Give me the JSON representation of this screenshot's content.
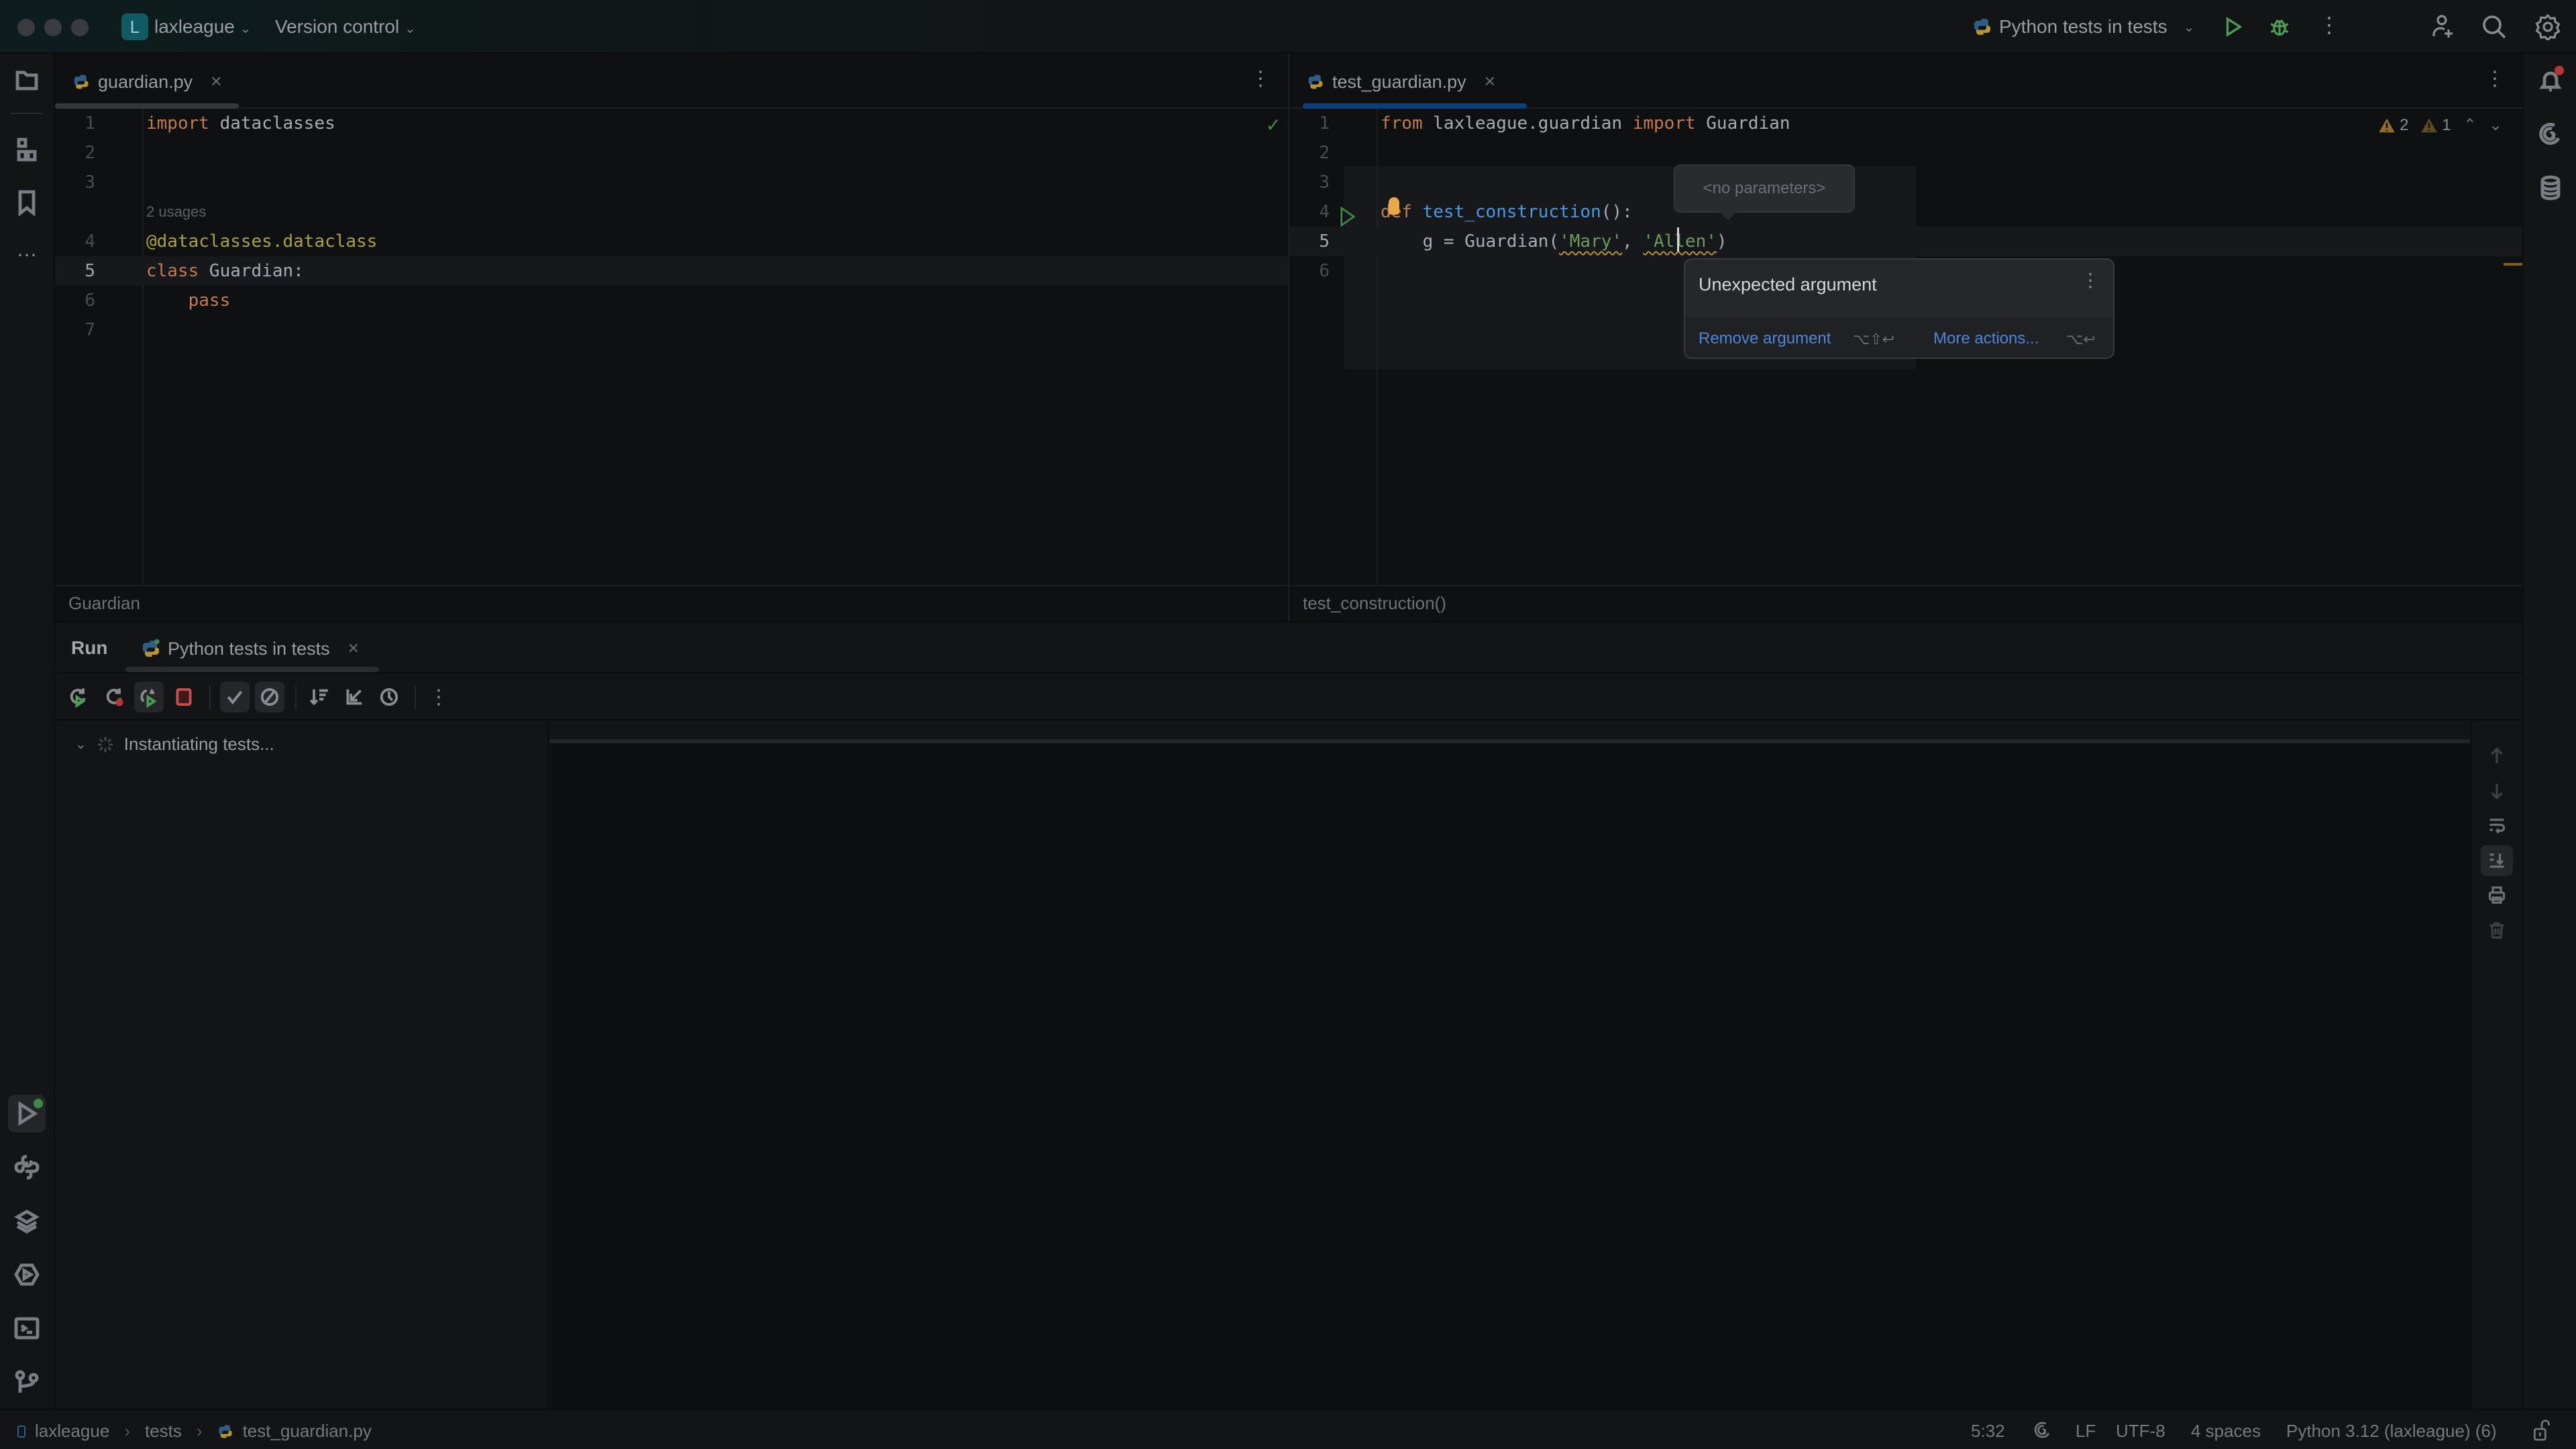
{
  "titlebar": {
    "project_initial": "L",
    "project_name": "laxleague",
    "vcs_label": "Version control",
    "run_config": "Python tests in tests"
  },
  "editors": {
    "left": {
      "tab_label": "guardian.py",
      "breadcrumb": "Guardian",
      "usages_hint": "2 usages",
      "lines": [
        {
          "n": "1",
          "tokens": [
            {
              "t": "import",
              "c": "kw"
            },
            {
              "t": " dataclasses",
              "c": "id"
            }
          ]
        },
        {
          "n": "2",
          "tokens": []
        },
        {
          "n": "3",
          "tokens": []
        },
        {
          "n": "4",
          "tokens": [
            {
              "t": "@dataclasses.dataclass",
              "c": "deco"
            }
          ]
        },
        {
          "n": "5",
          "tokens": [
            {
              "t": "class",
              "c": "kw"
            },
            {
              "t": " Guardian:",
              "c": "id"
            }
          ]
        },
        {
          "n": "6",
          "tokens": [
            {
              "t": "    ",
              "c": "id"
            },
            {
              "t": "pass",
              "c": "kw"
            }
          ]
        },
        {
          "n": "7",
          "tokens": []
        }
      ]
    },
    "right": {
      "tab_label": "test_guardian.py",
      "breadcrumb": "test_construction()",
      "warnings_count": "2",
      "weak_warnings_count": "1",
      "lines": [
        {
          "n": "1",
          "tokens": [
            {
              "t": "from",
              "c": "kw"
            },
            {
              "t": " laxleague.guardian ",
              "c": "id"
            },
            {
              "t": "import",
              "c": "kw"
            },
            {
              "t": " Guardian",
              "c": "id"
            }
          ]
        },
        {
          "n": "2",
          "tokens": []
        },
        {
          "n": "3",
          "tokens": []
        },
        {
          "n": "4",
          "tokens": [
            {
              "t": "def",
              "c": "kw"
            },
            {
              "t": " ",
              "c": "id"
            },
            {
              "t": "test_construction",
              "c": "fn"
            },
            {
              "t": "():",
              "c": "id"
            }
          ]
        },
        {
          "n": "5",
          "tokens": [
            {
              "t": "    g = Guardian(",
              "c": "id"
            },
            {
              "t": "'Mary'",
              "c": "str squiggle"
            },
            {
              "t": ", ",
              "c": "id"
            },
            {
              "t": "'Allen'",
              "c": "str squiggle"
            },
            {
              "t": ")",
              "c": "id"
            }
          ]
        },
        {
          "n": "6",
          "tokens": []
        }
      ],
      "param_hint": "<no parameters>",
      "error_popup": {
        "title": "Unexpected argument",
        "primary_action": "Remove argument",
        "primary_shortcut": "⌥⇧↩",
        "secondary_action": "More actions...",
        "secondary_shortcut": "⌥↩"
      }
    }
  },
  "run_panel": {
    "label": "Run",
    "tab_label": "Python tests in tests",
    "tree_status": "Instantiating tests..."
  },
  "statusbar": {
    "breadcrumbs": [
      "laxleague",
      "tests",
      "test_guardian.py"
    ],
    "cursor_position": "5:32",
    "line_separator": "LF",
    "encoding": "UTF-8",
    "indent": "4 spaces",
    "interpreter": "Python 3.12 (laxleague) (6)"
  },
  "colors": {
    "accent_blue": "#0e3f7a",
    "run_green": "#4d9a56",
    "stop_red": "#c94f4f",
    "warning_amber": "#b8913b"
  }
}
